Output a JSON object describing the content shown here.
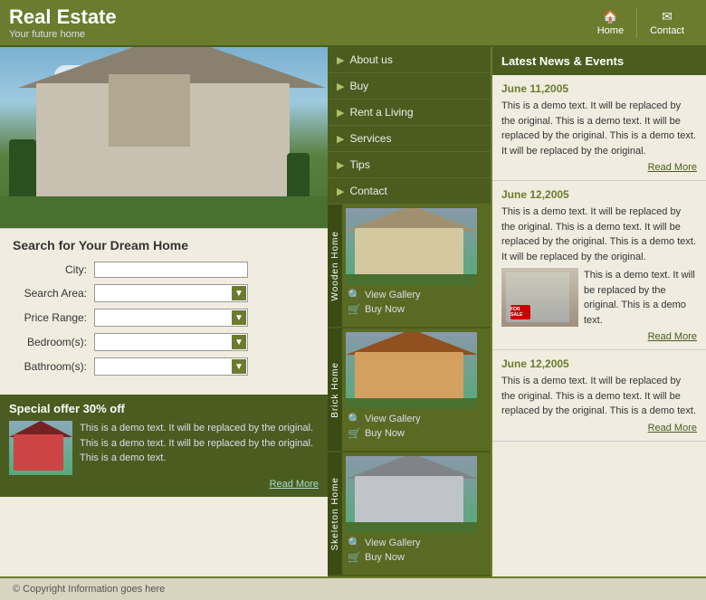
{
  "header": {
    "title": "Real Estate",
    "subtitle": "Your future home",
    "nav": [
      {
        "label": "Home",
        "icon": "🏠"
      },
      {
        "label": "Contact",
        "icon": "✉"
      }
    ]
  },
  "nav_menu": {
    "items": [
      {
        "label": "About us"
      },
      {
        "label": "Buy"
      },
      {
        "label": "Rent a Living"
      },
      {
        "label": "Services"
      },
      {
        "label": "Tips"
      },
      {
        "label": "Contact"
      }
    ]
  },
  "search": {
    "title": "Search for Your Dream Home",
    "fields": [
      {
        "label": "City:",
        "type": "text"
      },
      {
        "label": "Search Area:",
        "type": "select"
      },
      {
        "label": "Price Range:",
        "type": "select"
      },
      {
        "label": "Bedroom(s):",
        "type": "select"
      },
      {
        "label": "Bathroom(s):",
        "type": "select"
      }
    ]
  },
  "special_offer": {
    "title": "Special offer 30% off",
    "text": "This is a demo text. It will be replaced by the original. This is a demo text. It will be replaced by the original. This is a demo text.",
    "read_more": "Read More"
  },
  "properties": [
    {
      "label": "Wooden Home",
      "view_gallery": "View Gallery",
      "buy_now": "Buy Now"
    },
    {
      "label": "Brick Home",
      "view_gallery": "View Gallery",
      "buy_now": "Buy Now"
    },
    {
      "label": "Skeleton Home",
      "view_gallery": "View Gallery",
      "buy_now": "Buy Now"
    }
  ],
  "news": {
    "title": "Latest News & Events",
    "items": [
      {
        "date": "June 11,2005",
        "text": "This is a demo text. It will be replaced by the original. This is a demo text. It will be replaced by the original. This is a demo text. It will be replaced by the original.",
        "read_more": "Read More",
        "has_image": false
      },
      {
        "date": "June 12,2005",
        "text": "This is a demo text. It will be replaced by the original. This is a demo text. It will be replaced by the original. This is a demo text. It will be replaced by the original.",
        "read_more": "Read More",
        "has_image": true,
        "image_type": "people"
      },
      {
        "date": "June 12,2005",
        "text": "This is a demo text. It will be replaced by the original. This is a demo text. It will be replaced by the original. This is a demo text.",
        "read_more": "Read More",
        "has_image": false
      }
    ]
  },
  "footer": {
    "text": "© Copyright Information goes here"
  }
}
